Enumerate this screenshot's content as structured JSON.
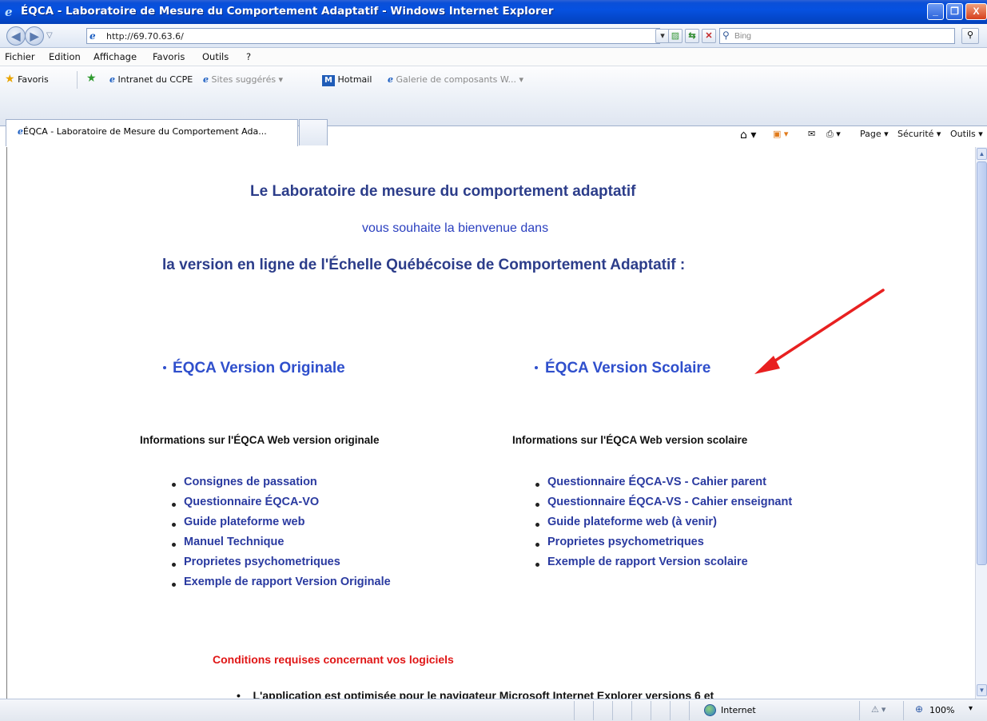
{
  "window": {
    "title": "ÉQCA - Laboratoire de Mesure du Comportement Adaptatif - Windows Internet Explorer",
    "buttons": {
      "minimize": "_",
      "maximize": "❐",
      "close": "X"
    }
  },
  "address_bar": {
    "url": "http://69.70.63.6/",
    "search_placeholder": "Bing"
  },
  "menu": [
    "Fichier",
    "Edition",
    "Affichage",
    "Favoris",
    "Outils",
    "?"
  ],
  "favorites_bar": {
    "favorites_label": "Favoris",
    "items": [
      "Intranet du CCPE",
      "Sites suggérés ▾",
      "Hotmail",
      "Galerie de composants W... ▾"
    ]
  },
  "tabs": [
    {
      "title": "ÉQCA - Laboratoire de Mesure du Comportement Ada..."
    }
  ],
  "command_bar": {
    "page": "Page ▾",
    "security": "Sécurité ▾",
    "tools": "Outils ▾"
  },
  "content": {
    "heading": "Le Laboratoire de mesure du comportement adaptatif",
    "welcome": "vous souhaite la bienvenue dans",
    "subheading": "la version en ligne de l'Échelle Québécoise de Comportement Adaptatif :",
    "left": {
      "link": "ÉQCA Version Originale",
      "info_heading": "Informations sur l'ÉQCA Web version originale",
      "items": [
        "Consignes de passation",
        "Questionnaire ÉQCA-VO",
        "Guide plateforme web",
        "Manuel Technique",
        "Proprietes psychometriques",
        "Exemple de rapport Version Originale"
      ]
    },
    "right": {
      "link": "ÉQCA Version Scolaire",
      "info_heading": "Informations sur l'ÉQCA Web version scolaire",
      "items": [
        "Questionnaire ÉQCA-VS - Cahier parent",
        "Questionnaire ÉQCA-VS - Cahier enseignant",
        "Guide plateforme web (à venir)",
        "Proprietes psychometriques",
        "Exemple de rapport Version scolaire"
      ]
    },
    "requirements_heading": "Conditions requises concernant vos logiciels",
    "requirements_first_line": "L'application est optimisée pour le navigateur Microsoft Internet Explorer versions 6 et"
  },
  "status_bar": {
    "zone": "Internet",
    "zoom": "100%"
  },
  "colors": {
    "titlebar": "#0651e0",
    "link": "#2f4fcc",
    "heading": "#2c3d8a",
    "warning": "#e01616",
    "arrow": "#e82020"
  }
}
